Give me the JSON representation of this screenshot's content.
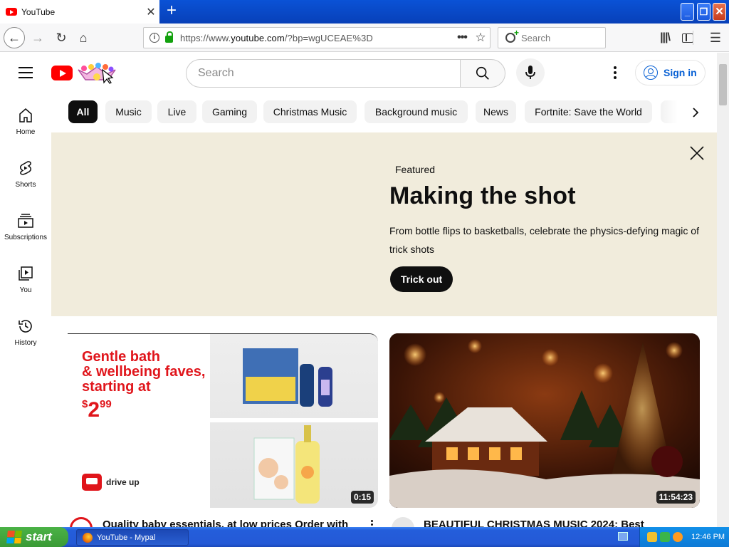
{
  "browser": {
    "tab_title": "YouTube",
    "url_prefix": "https://www.",
    "url_domain": "youtube.com",
    "url_path": "/?bp=wgUCEAE%3D",
    "search_placeholder": "Search",
    "new_tab_glyph": "+",
    "close_tab_glyph": "✕",
    "window_buttons": {
      "minimize": "_",
      "maximize": "❐",
      "close": "✕"
    },
    "nav_glyphs": {
      "back": "←",
      "forward": "→",
      "reload": "↻",
      "home": "⌂",
      "more": "•••",
      "star": "☆",
      "library": "|||\\",
      "menu": "☰"
    }
  },
  "youtube": {
    "search_placeholder": "Search",
    "signin_label": "Sign in",
    "left_nav": [
      {
        "label": "Home",
        "icon": "home-icon"
      },
      {
        "label": "Shorts",
        "icon": "shorts-icon"
      },
      {
        "label": "Subscriptions",
        "icon": "subscriptions-icon"
      },
      {
        "label": "You",
        "icon": "you-icon"
      },
      {
        "label": "History",
        "icon": "history-icon"
      }
    ],
    "chips": [
      {
        "label": "All",
        "active": true
      },
      {
        "label": "Music"
      },
      {
        "label": "Live"
      },
      {
        "label": "Gaming"
      },
      {
        "label": "Christmas Music"
      },
      {
        "label": "Background music"
      },
      {
        "label": "News"
      },
      {
        "label": "Fortnite: Save the World"
      }
    ],
    "banner": {
      "kicker": "Featured",
      "title": "Making the shot",
      "description": "From bottle flips to basketballs, celebrate the physics-defying magic of trick shots",
      "button_label": "Trick out",
      "background": "#f1ecdc"
    },
    "videos": [
      {
        "title": "Quality baby essentials, at low prices Order with",
        "duration": "0:15",
        "ad": {
          "headline_lines": [
            "Gentle bath",
            "& wellbeing faves,",
            "starting at"
          ],
          "price_currency": "$",
          "price_whole": "2",
          "price_cents": "99",
          "drive_label": "drive up"
        }
      },
      {
        "title": "BEAUTIFUL CHRISTMAS MUSIC 2024: Best",
        "duration": "11:54:23"
      }
    ],
    "accent_color": "#065fd4",
    "brand_red": "#ff0000"
  },
  "taskbar": {
    "start_label": "start",
    "task_label": "YouTube - Mypal",
    "clock": "12:46 PM"
  }
}
